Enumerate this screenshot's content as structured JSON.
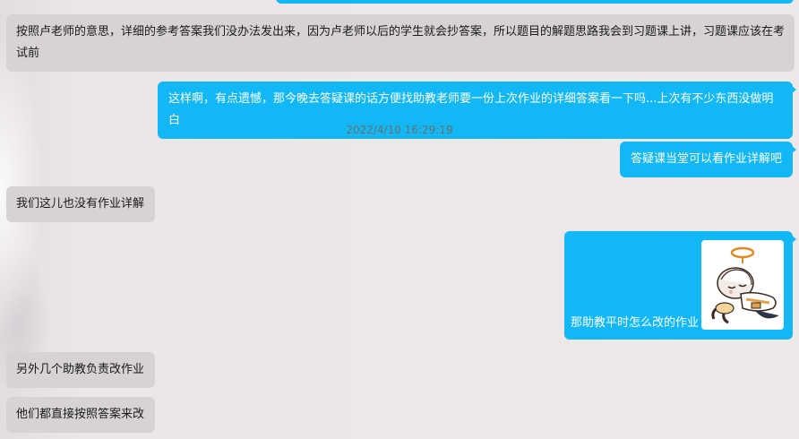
{
  "chat": {
    "timestamp": "2022/4/10 16:29:19",
    "messages": [
      {
        "side": "left",
        "text": "按照卢老师的意思，详细的参考答案我们没办法发出来，因为卢老师以后的学生就会抄答案，所以题目的解题思路我会到习题课上讲，习题课应该在考试前"
      },
      {
        "side": "right",
        "text": "这样啊，有点遗憾，那今晚去答疑课的话方便找助教老师要一份上次作业的详细答案看一下吗...上次有不少东西没做明白"
      },
      {
        "side": "right",
        "text": "答疑课当堂可以看作业详解吧"
      },
      {
        "side": "left",
        "text": "我们这儿也没有作业详解"
      },
      {
        "side": "right",
        "text": "那助教平时怎么改的作业",
        "sticker": "chibi-character-sticker"
      },
      {
        "side": "left",
        "text": "另外几个助教负责改作业"
      },
      {
        "side": "left",
        "text": "他们都直接按照答案来改"
      }
    ]
  },
  "colors": {
    "self_bubble": "#12b7f5",
    "other_bubble": "#d7d3d5",
    "background": "#ece7e8"
  }
}
